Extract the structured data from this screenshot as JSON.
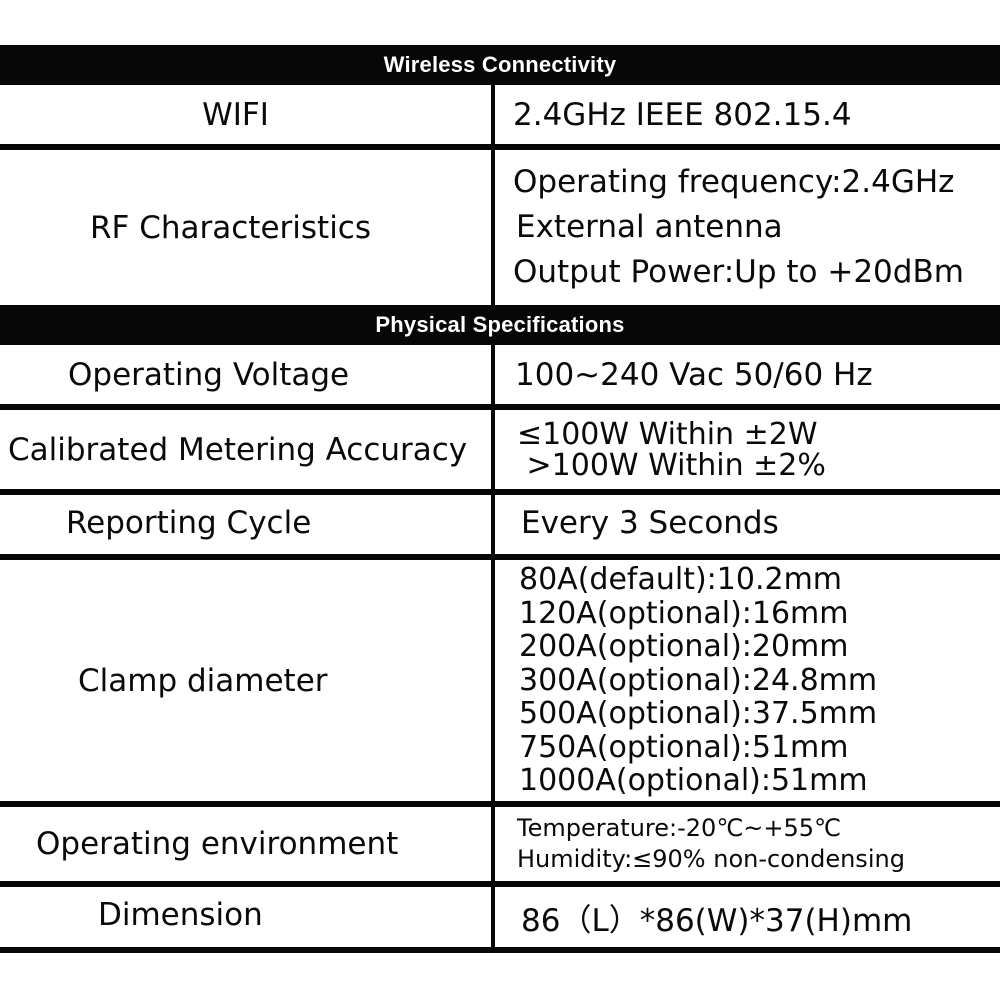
{
  "sections": {
    "wireless": {
      "title": "Wireless Connectivity",
      "rows": {
        "wifi": {
          "label": "WIFI",
          "values": [
            "2.4GHz IEEE 802.15.4"
          ]
        },
        "rf": {
          "label": "RF Characteristics",
          "values": [
            "Operating frequency:2.4GHz",
            "External antenna",
            "Output Power:Up to +20dBm"
          ]
        }
      }
    },
    "physical": {
      "title": "Physical Specifications",
      "rows": {
        "voltage": {
          "label": "Operating Voltage",
          "values": [
            "100~240 Vac 50/60 Hz"
          ]
        },
        "accuracy": {
          "label": "Calibrated Metering Accuracy",
          "values": [
            "≤100W Within ±2W",
            " >100W Within ±2%"
          ]
        },
        "cycle": {
          "label": "Reporting Cycle",
          "values": [
            "Every 3 Seconds"
          ]
        },
        "clamp": {
          "label": "Clamp diameter",
          "values": [
            "80A(default):10.2mm",
            "120A(optional):16mm",
            "200A(optional):20mm",
            "300A(optional):24.8mm",
            "500A(optional):37.5mm",
            "750A(optional):51mm",
            "1000A(optional):51mm"
          ]
        },
        "environment": {
          "label": "Operating environment",
          "values": [
            "Temperature:-20℃~+55℃",
            "Humidity:≤90% non-condensing"
          ]
        },
        "dimension": {
          "label": "Dimension",
          "values": [
            "86（L）*86(W)*37(H)mm"
          ]
        }
      }
    }
  }
}
